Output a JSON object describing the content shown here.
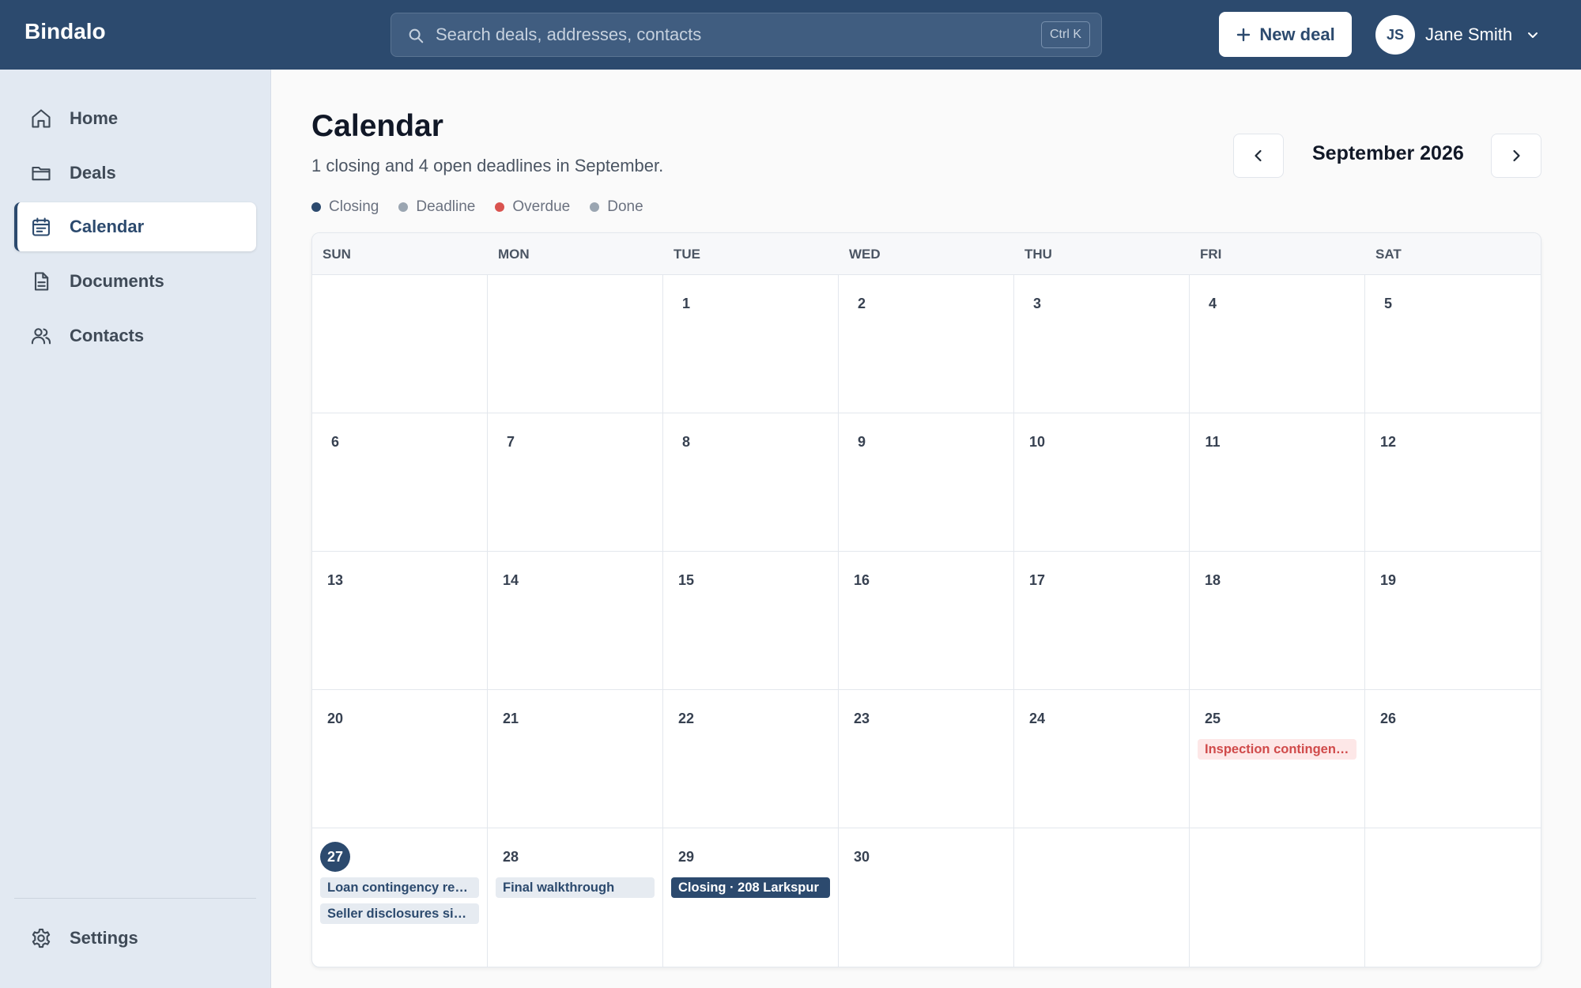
{
  "app": {
    "brand": "Bindalo"
  },
  "search": {
    "placeholder": "Search deals, addresses, contacts",
    "shortcut": "Ctrl K"
  },
  "header": {
    "new_deal_label": "New deal",
    "user_initials": "JS",
    "user_name": "Jane Smith"
  },
  "sidebar": {
    "items": [
      {
        "label": "Home",
        "icon": "home-icon"
      },
      {
        "label": "Deals",
        "icon": "folder-icon"
      },
      {
        "label": "Calendar",
        "icon": "calendar-icon",
        "active": true
      },
      {
        "label": "Documents",
        "icon": "document-icon"
      },
      {
        "label": "Contacts",
        "icon": "users-icon"
      }
    ],
    "settings_label": "Settings"
  },
  "page": {
    "title": "Calendar",
    "subtitle": "1 closing and 4 open deadlines in September.",
    "month_label": "September 2026"
  },
  "legend": [
    {
      "label": "Closing",
      "color": "#2c4a6e"
    },
    {
      "label": "Deadline",
      "color": "#9aa5b1"
    },
    {
      "label": "Overdue",
      "color": "#d9534f"
    },
    {
      "label": "Done",
      "color": "#9aa5b1"
    }
  ],
  "calendar": {
    "weekdays": [
      "SUN",
      "MON",
      "TUE",
      "WED",
      "THU",
      "FRI",
      "SAT"
    ],
    "today": 27,
    "weeks": [
      [
        null,
        null,
        1,
        2,
        3,
        4,
        5
      ],
      [
        6,
        7,
        8,
        9,
        10,
        11,
        12
      ],
      [
        13,
        14,
        15,
        16,
        17,
        18,
        19
      ],
      [
        20,
        21,
        22,
        23,
        24,
        25,
        26
      ],
      [
        27,
        28,
        29,
        30,
        null,
        null,
        null
      ]
    ],
    "events": {
      "25": [
        {
          "label": "Inspection contingency",
          "type": "overdue"
        }
      ],
      "27": [
        {
          "label": "Loan contingency removal",
          "type": "deadline"
        },
        {
          "label": "Seller disclosures signed",
          "type": "deadline"
        }
      ],
      "28": [
        {
          "label": "Final walkthrough",
          "type": "deadline"
        }
      ],
      "29": [
        {
          "label": "Closing · 208 Larkspur",
          "type": "closing"
        }
      ]
    }
  }
}
